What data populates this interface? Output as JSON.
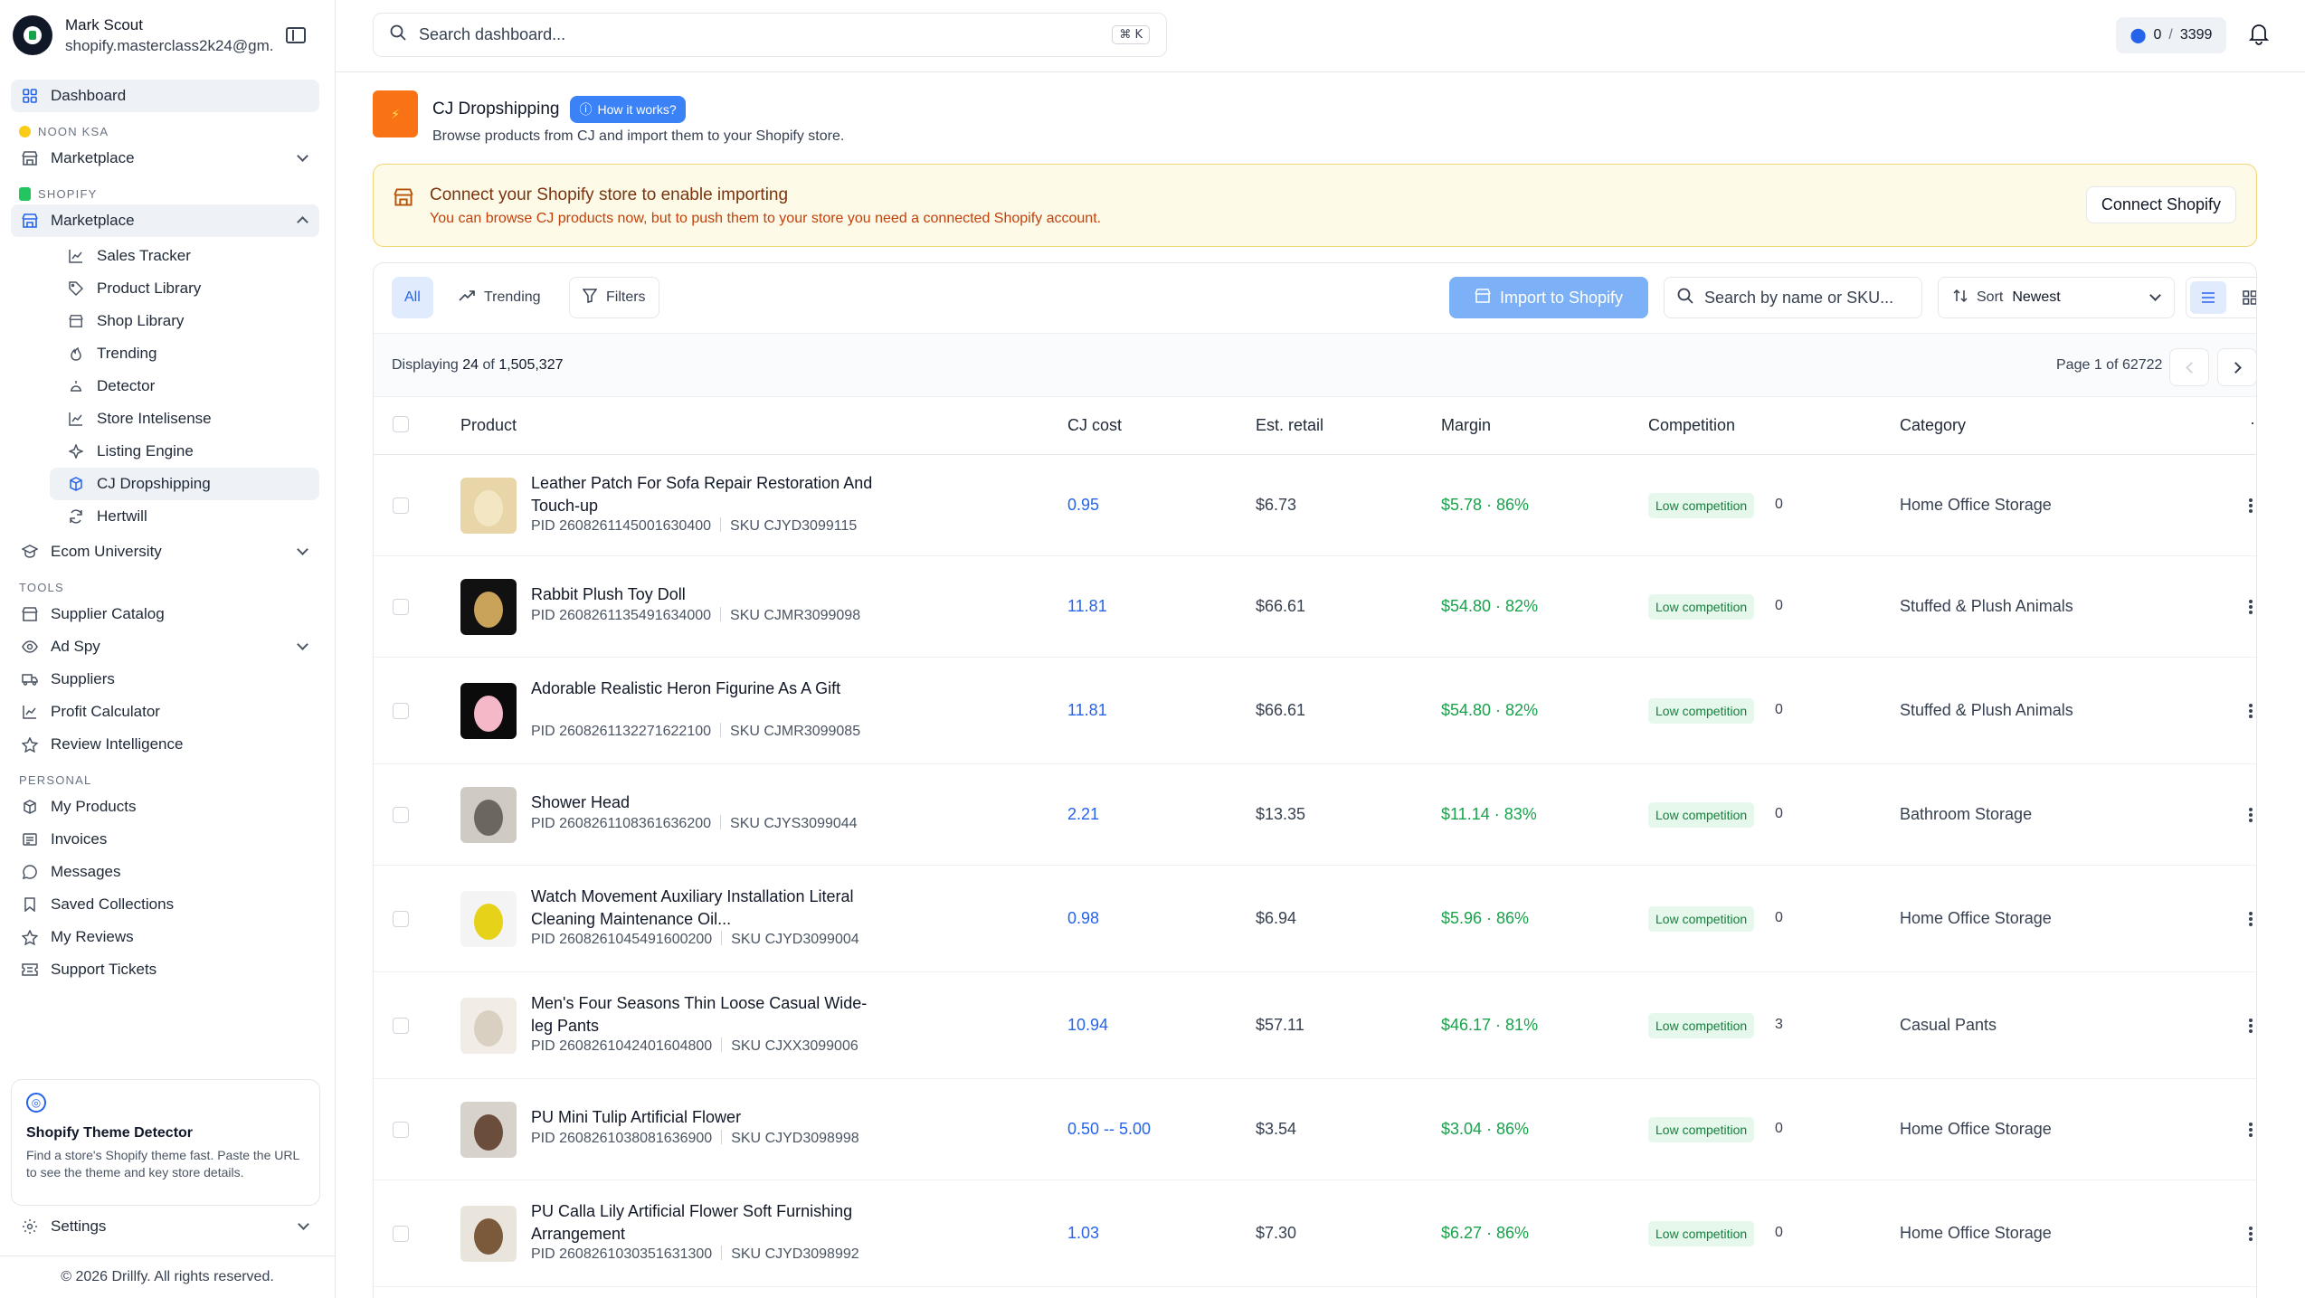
{
  "user": {
    "name": "Mark Scout",
    "email": "shopify.masterclass2k24@gm..."
  },
  "sidebar": {
    "dashboard": "Dashboard",
    "noon_label": "NOON KSA",
    "noon_marketplace": "Marketplace",
    "shopify_label": "SHOPIFY",
    "shopify_marketplace": "Marketplace",
    "sub_items": [
      "Sales Tracker",
      "Product Library",
      "Shop Library",
      "Trending",
      "Detector",
      "Store Intelisense",
      "Listing Engine",
      "CJ Dropshipping",
      "Hertwill"
    ],
    "ecom_university": "Ecom University",
    "tools_label": "TOOLS",
    "tools": [
      "Supplier Catalog",
      "Ad Spy",
      "Suppliers",
      "Profit Calculator",
      "Review Intelligence"
    ],
    "personal_label": "PERSONAL",
    "personal": [
      "My Products",
      "Invoices",
      "Messages",
      "Saved Collections",
      "My Reviews",
      "Support Tickets"
    ],
    "theme_card": {
      "title": "Shopify Theme Detector",
      "desc": "Find a store's Shopify theme fast. Paste the URL to see the theme and key store details."
    },
    "settings": "Settings",
    "footer": "© 2026 Drillfy. All rights reserved."
  },
  "topbar": {
    "search_placeholder": "Search dashboard...",
    "shortcut": "⌘ K",
    "credits_used": "0",
    "credits_sep": "/",
    "credits_total": "3399"
  },
  "page": {
    "title": "CJ Dropshipping",
    "how_it_works": "How it works?",
    "subtitle": "Browse products from CJ and import them to your Shopify store."
  },
  "banner": {
    "title": "Connect your Shopify store to enable importing",
    "desc": "You can browse CJ products now, but to push them to your store you need a connected Shopify account.",
    "button": "Connect Shopify"
  },
  "toolbar": {
    "all": "All",
    "trending": "Trending",
    "filters": "Filters",
    "import": "Import to Shopify",
    "search_placeholder": "Search by name or SKU...",
    "sort_label": "Sort",
    "sort_value": "Newest"
  },
  "info": {
    "displaying_prefix": "Displaying",
    "shown": "24",
    "of": "of",
    "total": "1,505,327",
    "page_text": "Page 1 of 62722"
  },
  "table": {
    "headers": {
      "product": "Product",
      "cost": "CJ cost",
      "retail": "Est. retail",
      "margin": "Margin",
      "competition": "Competition",
      "category": "Category",
      "more": "·"
    },
    "pid_label": "PID",
    "sku_label": "SKU",
    "rows": [
      {
        "name": "Leather Patch For Sofa Repair Restoration And Touch-up",
        "pid": "2608261145001630400",
        "sku": "CJYD3099115",
        "cost": "0.95",
        "retail": "$6.73",
        "margin": "$5.78 · 86%",
        "competition": "Low competition",
        "count": "0",
        "category": "Home Office Storage",
        "thumb_bg": "#e8d6a8",
        "thumb_fg": "#f3e7c3"
      },
      {
        "name": "Rabbit Plush Toy Doll",
        "pid": "2608261135491634000",
        "sku": "CJMR3099098",
        "cost": "11.81",
        "retail": "$66.61",
        "margin": "$54.80 · 82%",
        "competition": "Low competition",
        "count": "0",
        "category": "Stuffed & Plush Animals",
        "thumb_bg": "#111111",
        "thumb_fg": "#c9a35a"
      },
      {
        "name": "Adorable Realistic Heron Figurine As A Gift",
        "pid": "2608261132271622100",
        "sku": "CJMR3099085",
        "cost": "11.81",
        "retail": "$66.61",
        "margin": "$54.80 · 82%",
        "competition": "Low competition",
        "count": "0",
        "category": "Stuffed & Plush Animals",
        "thumb_bg": "#0b0b0b",
        "thumb_fg": "#f4b8c8"
      },
      {
        "name": "Shower Head",
        "pid": "2608261108361636200",
        "sku": "CJYS3099044",
        "cost": "2.21",
        "retail": "$13.35",
        "margin": "$11.14 · 83%",
        "competition": "Low competition",
        "count": "0",
        "category": "Bathroom Storage",
        "thumb_bg": "#cfcac3",
        "thumb_fg": "#6b6660"
      },
      {
        "name": "Watch Movement Auxiliary Installation Literal Cleaning Maintenance Oil...",
        "pid": "2608261045491600200",
        "sku": "CJYD3099004",
        "cost": "0.98",
        "retail": "$6.94",
        "margin": "$5.96 · 86%",
        "competition": "Low competition",
        "count": "0",
        "category": "Home Office Storage",
        "thumb_bg": "#f4f4f4",
        "thumb_fg": "#e7d21a"
      },
      {
        "name": "Men's Four Seasons Thin Loose Casual Wide-leg Pants",
        "pid": "2608261042401604800",
        "sku": "CJXX3099006",
        "cost": "10.94",
        "retail": "$57.11",
        "margin": "$46.17 · 81%",
        "competition": "Low competition",
        "count": "3",
        "category": "Casual Pants",
        "thumb_bg": "#f1ede6",
        "thumb_fg": "#d9d0c2"
      },
      {
        "name": "PU Mini Tulip Artificial Flower",
        "pid": "2608261038081636900",
        "sku": "CJYD3098998",
        "cost": "0.50 -- 5.00",
        "retail": "$3.54",
        "margin": "$3.04 · 86%",
        "competition": "Low competition",
        "count": "0",
        "category": "Home Office Storage",
        "thumb_bg": "#d8d2cc",
        "thumb_fg": "#6b4d3c"
      },
      {
        "name": "PU Calla Lily Artificial Flower Soft Furnishing Arrangement",
        "pid": "2608261030351631300",
        "sku": "CJYD3098992",
        "cost": "1.03",
        "retail": "$7.30",
        "margin": "$6.27 · 86%",
        "competition": "Low competition",
        "count": "0",
        "category": "Home Office Storage",
        "thumb_bg": "#e9e4dc",
        "thumb_fg": "#7a5a3a"
      }
    ]
  },
  "colors": {
    "accent": "#2563eb",
    "margin_green": "#16a34a",
    "banner_bg": "#fefae8",
    "cj_orange": "#f97316"
  }
}
